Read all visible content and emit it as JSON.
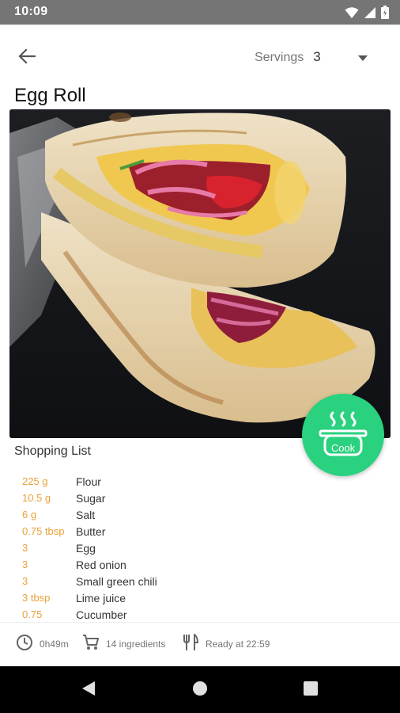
{
  "status_bar": {
    "time": "10:09",
    "icons": [
      "wifi-icon",
      "signal-icon",
      "battery-icon"
    ]
  },
  "app_bar": {
    "back_icon": "arrow-left-icon",
    "servings_label": "Servings",
    "servings_value": "3",
    "dropdown_icon": "caret-down-icon"
  },
  "recipe": {
    "title": "Egg Roll",
    "image_alt": "Egg roll with red onion and tomato filling"
  },
  "cook_button": {
    "label": "Cook",
    "icon": "steaming-pot-icon",
    "color": "#2ad17f"
  },
  "shopping_list": {
    "heading": "Shopping List",
    "items": [
      {
        "qty": "225 g",
        "name": "Flour"
      },
      {
        "qty": "10.5 g",
        "name": "Sugar"
      },
      {
        "qty": "6 g",
        "name": "Salt"
      },
      {
        "qty": "0.75 tbsp",
        "name": "Butter"
      },
      {
        "qty": "3",
        "name": "Egg"
      },
      {
        "qty": "3",
        "name": "Red onion"
      },
      {
        "qty": "3",
        "name": "Small green chili"
      },
      {
        "qty": "3 tbsp",
        "name": "Lime juice"
      },
      {
        "qty": "0.75",
        "name": "Cucumber"
      }
    ],
    "qty_color": "#e8a23a"
  },
  "info_bar": {
    "time": "0h49m",
    "ingredients": "14 ingredients",
    "ready": "Ready at 22:59"
  },
  "nav_bar": {
    "buttons": [
      "back-triangle-icon",
      "home-circle-icon",
      "recents-square-icon"
    ]
  }
}
